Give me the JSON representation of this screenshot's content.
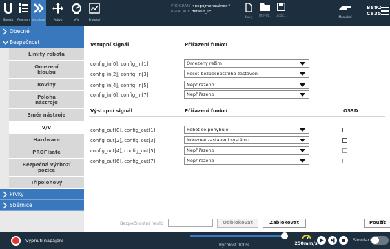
{
  "header": {
    "tools": [
      {
        "label": "Spustit",
        "icon": "ur-logo-icon"
      },
      {
        "label": "Program",
        "icon": "program-icon"
      },
      {
        "label": "Instalace",
        "icon": "installation-icon"
      },
      {
        "label": "Pohyb",
        "icon": "move-icon"
      },
      {
        "label": "V/V",
        "icon": "io-icon"
      },
      {
        "label": "Protokol",
        "icon": "log-icon"
      }
    ],
    "program_key": "PROGRAM",
    "program_value": "<nepojmenováno>*",
    "installation_key": "INSTALACE",
    "installation_value": "default_1*",
    "file_buttons": [
      {
        "label": "Nový",
        "icon": "new-file-icon"
      },
      {
        "label": "Otevřít...",
        "icon": "open-folder-icon"
      },
      {
        "label": "Uložit...",
        "icon": "save-icon"
      }
    ],
    "mode_label": "Manuální",
    "robot_line1": "B892",
    "robot_line2": "C835"
  },
  "sidebar": {
    "groups": [
      {
        "label": "Obecné",
        "expanded": false
      },
      {
        "label": "Bezpečnost",
        "expanded": true
      }
    ],
    "safety_items": [
      {
        "label": "Limity robota"
      },
      {
        "label": "Omezení kloubu"
      },
      {
        "label": "Roviny"
      },
      {
        "label": "Poloha nástroje"
      },
      {
        "label": "Směr nástroje"
      },
      {
        "label": "V/V"
      },
      {
        "label": "Hardware"
      },
      {
        "label": "PROFIsafe"
      },
      {
        "label": "Bezpečná výchozí pozice"
      },
      {
        "label": "Třípolohový"
      }
    ],
    "bottom_groups": [
      {
        "label": "Prvky"
      },
      {
        "label": "Sběrnice"
      }
    ]
  },
  "inputs": {
    "col_signal": "Vstupní signál",
    "col_assign": "Přiřazení funkcí",
    "rows": [
      {
        "signal": "config_in[0], config_in[1]",
        "value": "Omezený režim"
      },
      {
        "signal": "config_in[2], config_in[3]",
        "value": "Reset bezpečnostního zastavení"
      },
      {
        "signal": "config_in[4], config_in[5]",
        "value": "Nepřiřazeno"
      },
      {
        "signal": "config_in[6], config_in[7]",
        "value": "Nepřiřazeno"
      }
    ]
  },
  "outputs": {
    "col_signal": "Výstupní signál",
    "col_assign": "Přiřazení funkcí",
    "col_ossd": "OSSD",
    "rows": [
      {
        "signal": "config_out[0], config_out[1]",
        "value": "Robot se pohybuje",
        "ossd": false
      },
      {
        "signal": "config_out[2], config_out[3]",
        "value": "Nouzové zastavení systému",
        "ossd": false
      },
      {
        "signal": "config_out[4], config_out[5]",
        "value": "Nepřiřazeno",
        "ossd": false
      },
      {
        "signal": "config_out[6], config_out[7]",
        "value": "Nepřiřazeno",
        "ossd": false
      }
    ]
  },
  "lockbar": {
    "password_label": "Bezpečnostní heslo",
    "password_value": "",
    "unlock_label": "Odblokovat",
    "lock_label": "Zablokovat",
    "apply_label": "Použít"
  },
  "footer": {
    "power_label": "Vypnutí napájení",
    "speed_label": "Rychlost 100%",
    "speed_percent": 100,
    "speed_value": "250mm/s",
    "sim_label": "Simulace",
    "sim_on": false
  },
  "colors": {
    "header_bg": "#1d2f3e",
    "accent": "#3a78bd",
    "power_red": "#e8322b"
  }
}
